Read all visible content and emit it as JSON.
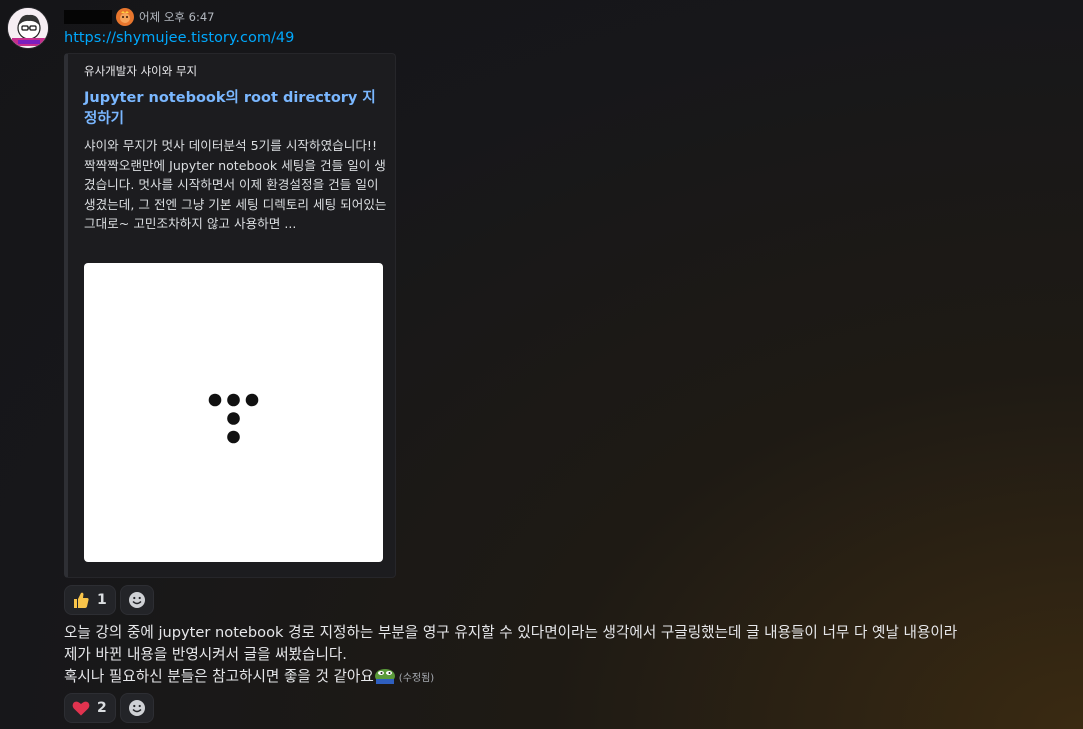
{
  "message": {
    "timestamp": "어제 오후 6:47",
    "link": "https://shymujee.tistory.com/49",
    "text_line1": "오늘 강의 중에 jupyter notebook 경로 지정하는 부분을 영구 유지할 수 있다면이라는 생각에서 구글링했는데 글 내용들이 너무 다 옛날 내용이라",
    "text_line2": "제가 바뀐 내용을 반영시켜서 글을 써봤습니다.",
    "text_line3": "혹시나 필요하신 분들은 참고하시면 좋을 것 같아요",
    "edited_label": "(수정됨)"
  },
  "embed": {
    "provider": "유사개발자 샤이와 무지",
    "title": "Jupyter notebook의 root directory 지정하기",
    "description": "샤이와 무지가 멋사 데이터분석 5기를 시작하였습니다!! 짝짝짝오랜만에 Jupyter notebook 세팅을 건들 일이 생겼습니다. 멋사를 시작하면서 이제 환경설정을 건들 일이 생겼는데, 그 전엔 그냥 기본 세팅 디렉토리 세팅 되어있는 그대로~ 고민조차하지 않고 사용하면 ..."
  },
  "reactions_embed": [
    {
      "emoji": "thumbs-up-icon",
      "count": "1"
    }
  ],
  "reactions_message": [
    {
      "emoji": "heart-icon",
      "count": "2"
    }
  ],
  "colors": {
    "link": "#00a8fc",
    "embed_title": "#7ab7ff",
    "heart": "#e1334f",
    "thumb": "#f8c44a"
  }
}
